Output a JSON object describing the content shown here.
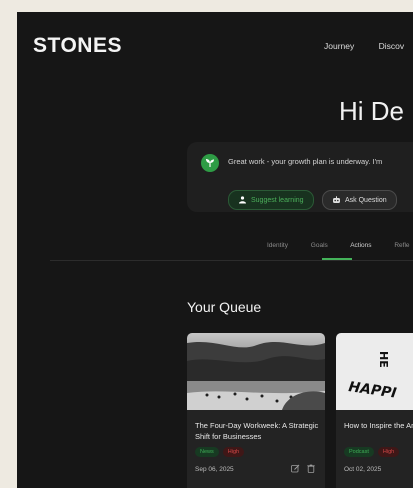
{
  "header": {
    "logo": "STONES",
    "nav": [
      "Journey",
      "Discov"
    ]
  },
  "greeting": "Hi De",
  "growth_card": {
    "message": "Great work - your growth plan is underway. I'm",
    "suggest_label": "Suggest learning",
    "ask_label": "Ask Question"
  },
  "tabs": [
    "Identity",
    "Goals",
    "Actions",
    "Refle"
  ],
  "active_tab": "Actions",
  "queue": {
    "title": "Your Queue",
    "cards": [
      {
        "title": "The Four-Day Workweek: A Strategic Shift for Businesses",
        "tags": [
          "News",
          "High"
        ],
        "date": "Sep 06, 2025"
      },
      {
        "title": "How to Inspire the Around You",
        "tags": [
          "Podcast",
          "High"
        ],
        "date": "Oct 02, 2025",
        "poster_text_top": "HE",
        "poster_text_main": "HAPPI"
      }
    ]
  },
  "colors": {
    "background": "#161616",
    "accent_green": "#44b35a",
    "high_red": "#d44848"
  }
}
